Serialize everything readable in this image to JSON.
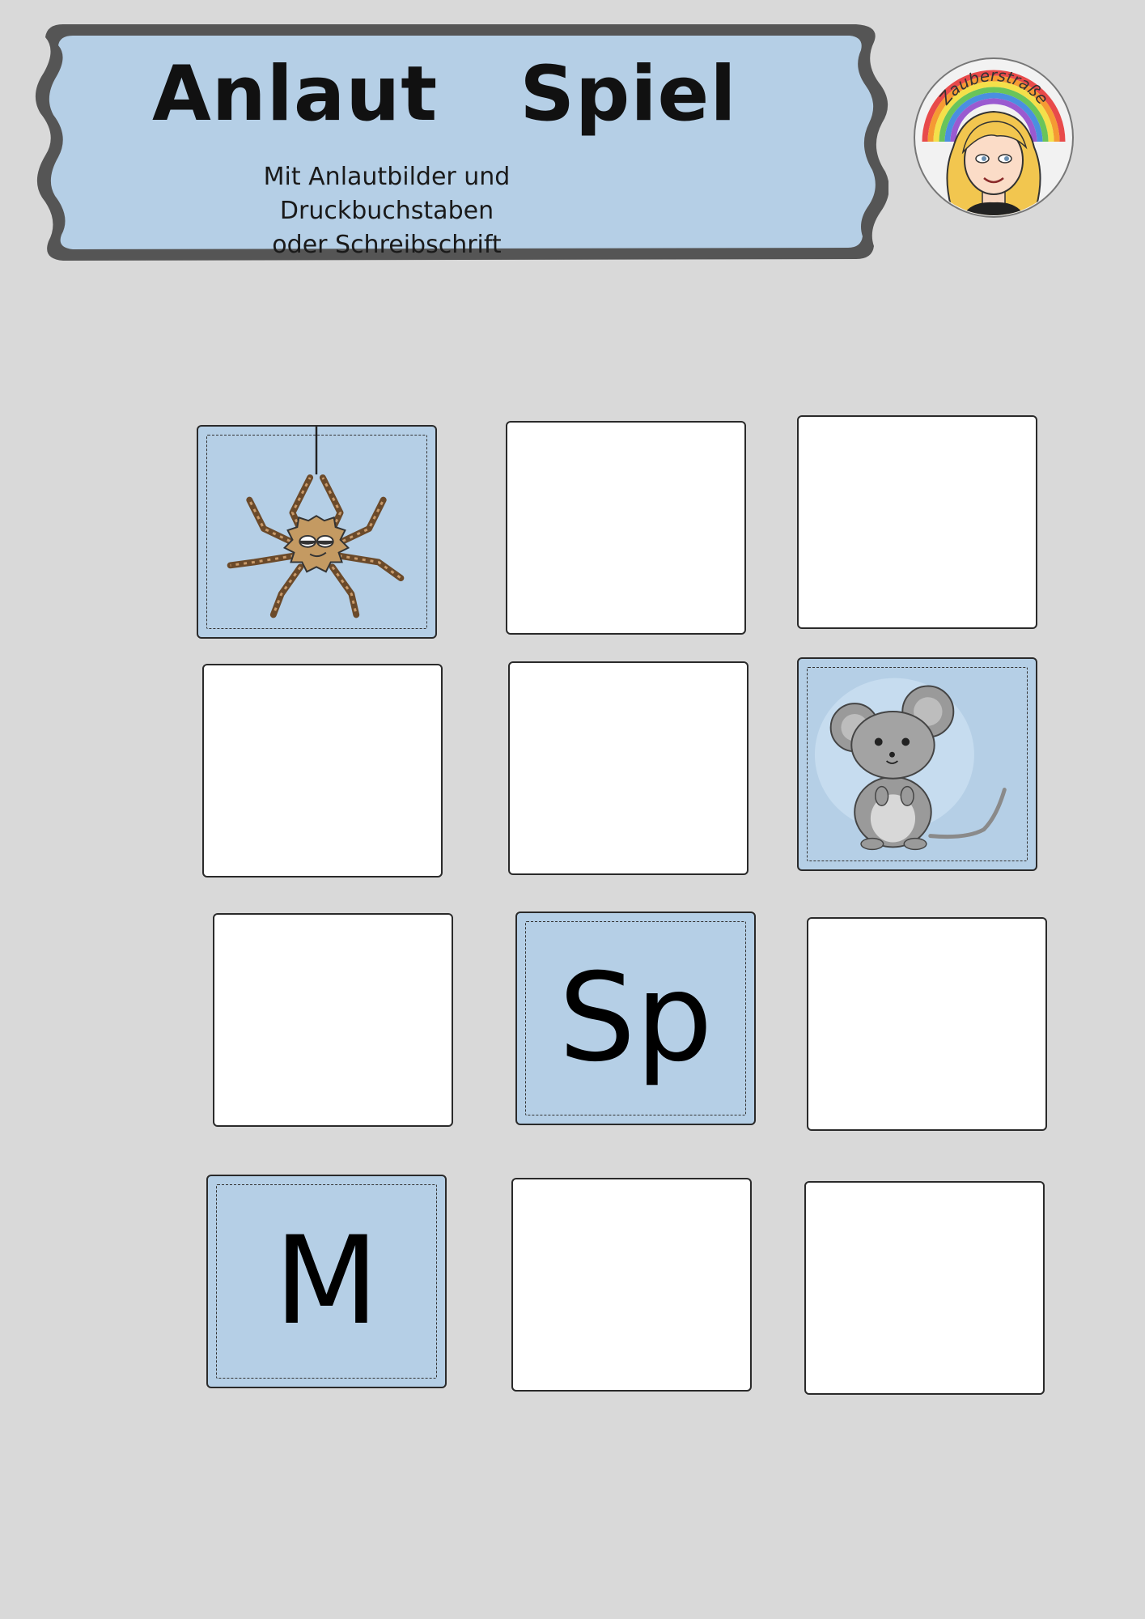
{
  "header": {
    "title": "Anlaut   Spiel",
    "subtitle_line1": "Mit Anlautbilder und Druckbuchstaben",
    "subtitle_line2": "oder Schreibschrift"
  },
  "logo": {
    "text": "Zauberstraße",
    "icon": "avatar-rainbow-logo-icon"
  },
  "colors": {
    "background": "#d9d9d9",
    "card_blue": "#b5cfe6",
    "banner_blue": "#b5cfe6",
    "banner_border": "#555555"
  },
  "cards": [
    {
      "type": "picture",
      "icon": "spider-icon"
    },
    {
      "type": "blank"
    },
    {
      "type": "blank"
    },
    {
      "type": "blank"
    },
    {
      "type": "blank"
    },
    {
      "type": "picture",
      "icon": "mouse-icon"
    },
    {
      "type": "blank"
    },
    {
      "type": "letter",
      "text": "Sp"
    },
    {
      "type": "blank"
    },
    {
      "type": "letter",
      "text": "M"
    },
    {
      "type": "blank"
    },
    {
      "type": "blank"
    }
  ]
}
